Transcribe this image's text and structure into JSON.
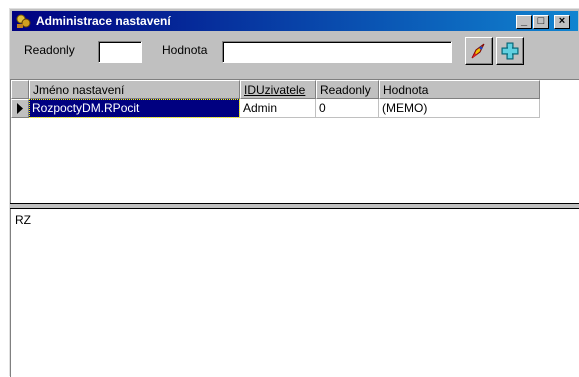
{
  "window": {
    "title": "Administrace nastavení"
  },
  "toolbar": {
    "readonly_label": "Readonly",
    "readonly_value": "",
    "hodnota_label": "Hodnota",
    "hodnota_value": "",
    "run_icon": "rocket-icon",
    "add_icon": "plus-icon"
  },
  "grid": {
    "columns": [
      "Jméno nastavení",
      "IDUzivatele",
      "Readonly",
      "Hodnota"
    ],
    "rows": [
      {
        "name": "RozpoctyDM.RPocit",
        "user": "Admin",
        "readonly": "0",
        "value": "(MEMO)"
      }
    ]
  },
  "memo": {
    "text": "RZ"
  },
  "colors": {
    "title_start": "#000080",
    "title_end": "#1084d0",
    "selection": "#000080",
    "face": "#c0c0c0"
  }
}
